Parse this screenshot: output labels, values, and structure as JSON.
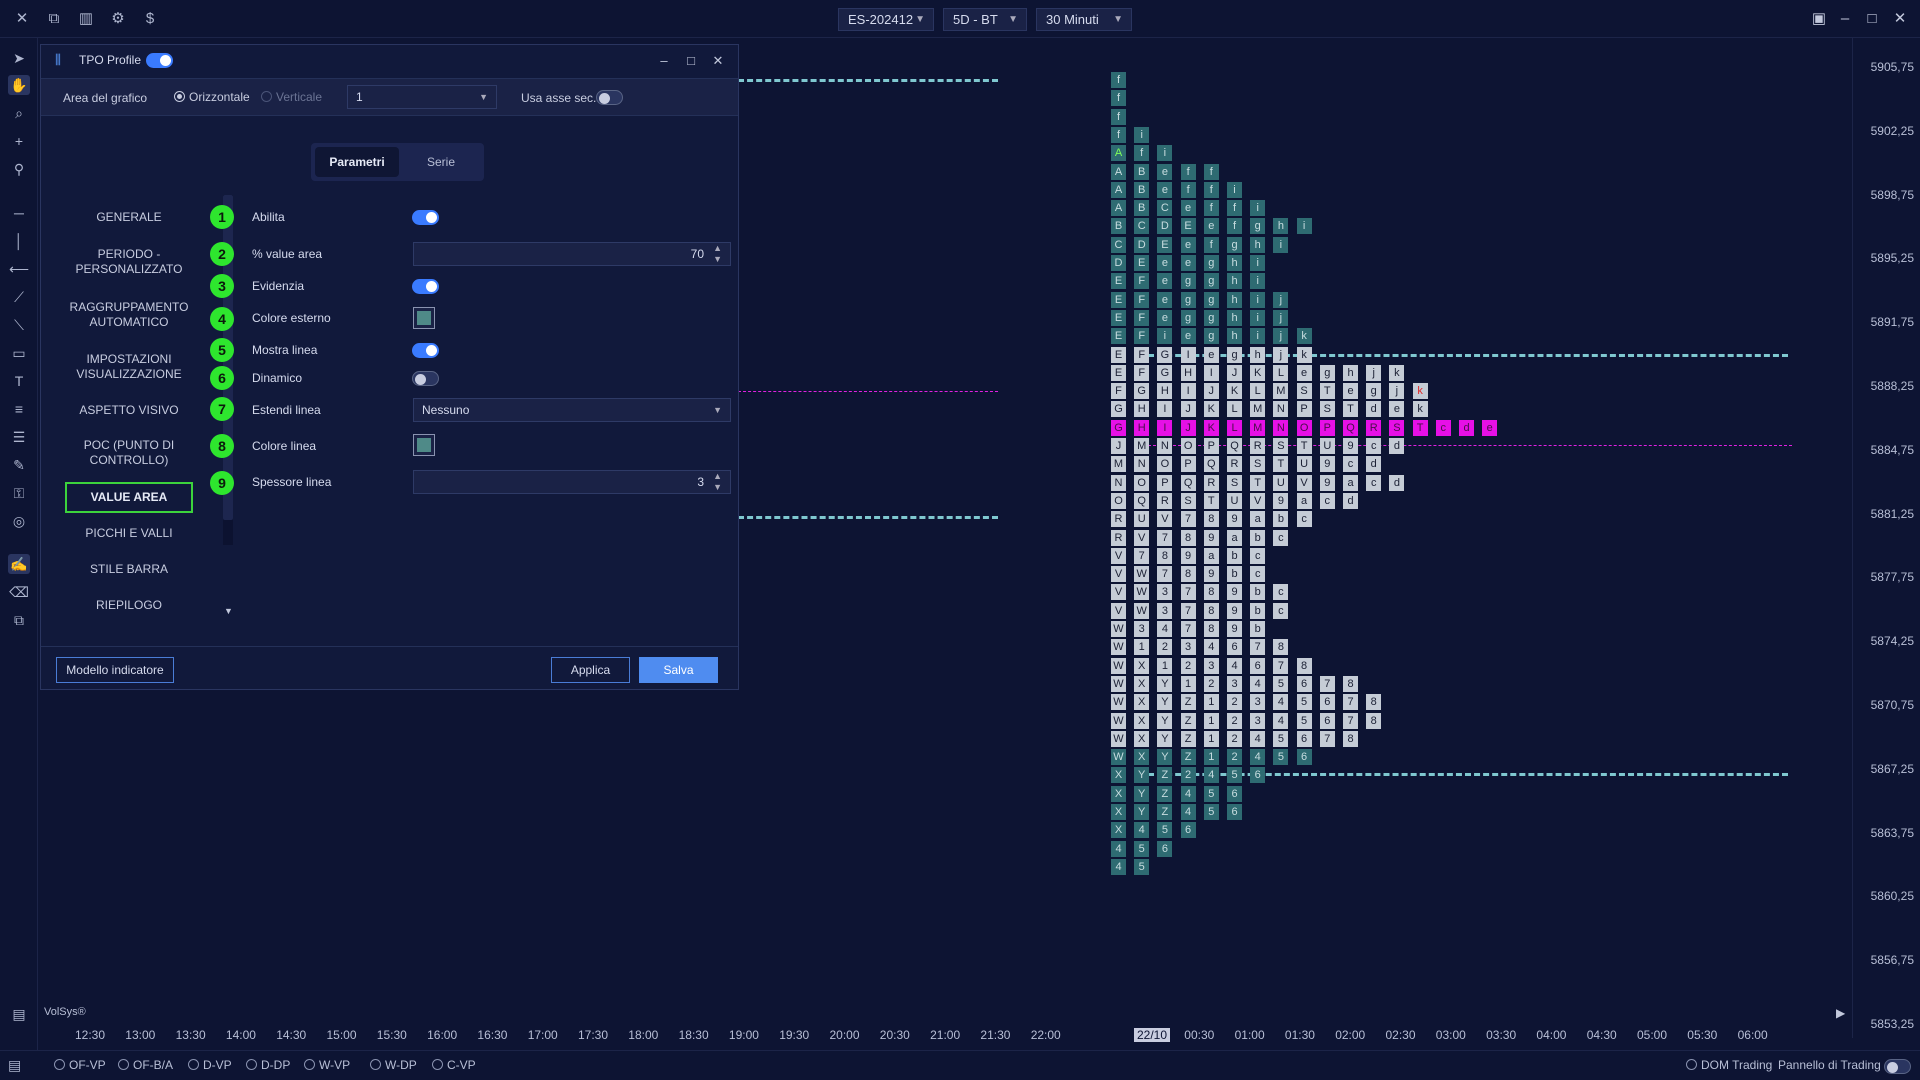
{
  "topbar": {
    "symbol": "ES-202412",
    "data_source": "5D - BT",
    "timeframe": "30 Minuti"
  },
  "price_axis": [
    "5905,75",
    "5902,25",
    "5898,75",
    "5895,25",
    "5891,75",
    "5888,25",
    "5884,75",
    "5881,25",
    "5877,75",
    "5874,25",
    "5870,75",
    "5867,25",
    "5863,75",
    "5860,25",
    "5856,75",
    "5853,25"
  ],
  "time_axis": [
    "12:30",
    "13:00",
    "13:30",
    "14:00",
    "14:30",
    "15:00",
    "15:30",
    "16:00",
    "16:30",
    "17:00",
    "17:30",
    "18:00",
    "18:30",
    "19:00",
    "19:30",
    "20:00",
    "20:30",
    "21:00",
    "21:30",
    "22:00",
    "22/10",
    "00:30",
    "01:00",
    "01:30",
    "02:00",
    "02:30",
    "03:00",
    "03:30",
    "04:00",
    "04:30",
    "05:00",
    "05:30",
    "06:00"
  ],
  "watermark": "VolSys®",
  "bottombar": {
    "profiles": [
      "OF-VP",
      "OF-B/A",
      "D-VP",
      "D-DP",
      "W-VP",
      "W-DP",
      "C-VP"
    ],
    "dom_trading": "DOM Trading",
    "trading_panel": "Pannello di Trading"
  },
  "dialog": {
    "title": "TPO Profile",
    "enabled": true,
    "area_label": "Area del grafico",
    "orientation_horizontal": "Orizzontale",
    "orientation_vertical": "Verticale",
    "area_value": "1",
    "secondary_axis_label": "Usa asse sec.",
    "tabs": [
      "Parametri",
      "Serie"
    ],
    "nav": [
      {
        "num": "1",
        "label": "GENERALE"
      },
      {
        "num": "2",
        "label": "PERIODO - PERSONALIZZATO"
      },
      {
        "num": "3",
        "label": "RAGGRUPPAMENTO AUTOMATICO"
      },
      {
        "num": "4",
        "label": "IMPOSTAZIONI VISUALIZZAZIONE"
      },
      {
        "num": "5",
        "label": "ASPETTO VISIVO"
      },
      {
        "num": "6",
        "label": "POC (PUNTO DI CONTROLLO)"
      },
      {
        "num": "7",
        "label": "VALUE AREA"
      },
      {
        "num": "8",
        "label": "PICCHI E VALLI"
      },
      {
        "num": "9",
        "label": "STILE BARRA"
      },
      {
        "num": "",
        "label": "RIEPILOGO"
      }
    ],
    "params": {
      "enable_label": "Abilita",
      "value_area_pct_label": "% value area",
      "value_area_pct": "70",
      "highlight_label": "Evidenzia",
      "outer_color_label": "Colore esterno",
      "show_line_label": "Mostra linea",
      "dynamic_label": "Dinamico",
      "extend_line_label": "Estendi linea",
      "extend_line_value": "Nessuno",
      "line_color_label": "Colore linea",
      "line_width_label": "Spessore linea",
      "line_width": "3"
    },
    "footer": {
      "template_button": "Modello indicatore",
      "apply_button": "Applica",
      "save_button": "Salva"
    }
  }
}
